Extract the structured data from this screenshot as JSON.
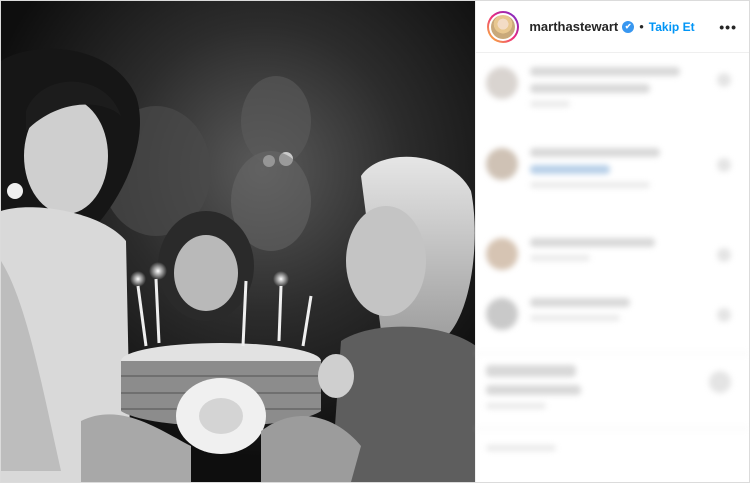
{
  "header": {
    "username": "marthastewart",
    "verified_glyph": "✔",
    "separator": "•",
    "follow_label": "Takip Et",
    "more_glyph": "•••"
  },
  "photo": {
    "subject": "birthday-cake-photo",
    "style": "black-and-white"
  },
  "colors": {
    "follow": "#0095f6",
    "verified": "#3897f0",
    "text": "#262626",
    "border": "#dbdbdb"
  }
}
